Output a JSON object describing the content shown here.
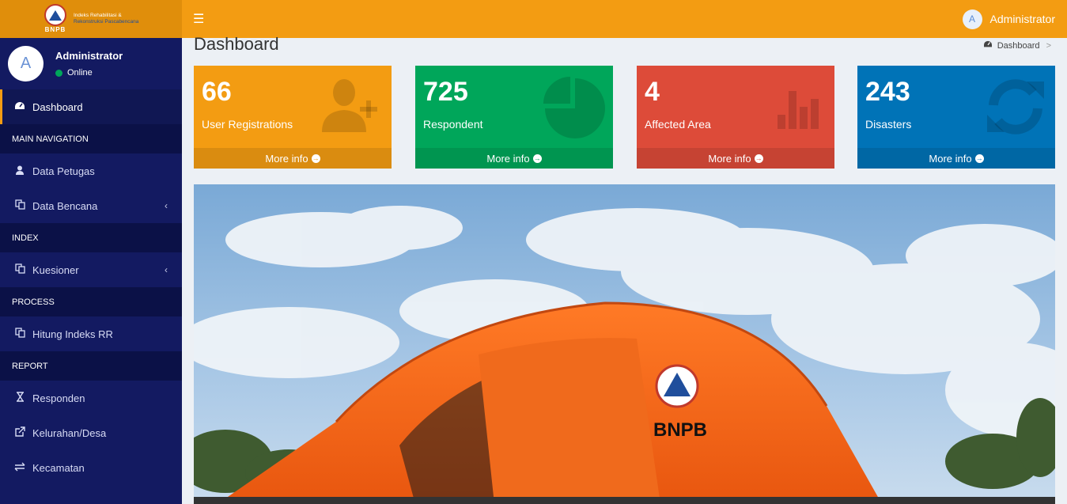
{
  "brand": {
    "logo_letters": "BNPB",
    "line1": "Indeks Rehabilitasi &",
    "line2": "Rekonstruksi Pascabencana"
  },
  "navbar": {
    "toggle_icon": "bars-icon",
    "user_initial": "A",
    "user_name": "Administrator"
  },
  "sidebar": {
    "user_initial": "A",
    "user_name": "Administrator",
    "user_status": "Online",
    "items": [
      {
        "label": "Dashboard",
        "icon": "dashboard-icon"
      },
      {
        "header": "MAIN NAVIGATION"
      },
      {
        "label": "Data Petugas",
        "icon": "user-icon"
      },
      {
        "label": "Data Bencana",
        "icon": "copy-icon"
      },
      {
        "header": "INDEX"
      },
      {
        "label": "Kuesioner",
        "icon": "copy-icon"
      },
      {
        "header": "PROCESS"
      },
      {
        "label": "Hitung Indeks RR",
        "icon": "copy-icon"
      },
      {
        "header": "REPORT"
      },
      {
        "label": "Responden",
        "icon": "hourglass-icon"
      },
      {
        "label": "Kelurahan/Desa",
        "icon": "external-link-icon"
      },
      {
        "label": "Kecamatan",
        "icon": "exchange-icon"
      }
    ]
  },
  "page": {
    "title": "Dashboard",
    "breadcrumb": "Dashboard",
    "breadcrumb_sep": ">"
  },
  "stats": [
    {
      "value": "66",
      "label": "User Registrations",
      "more": "More info",
      "icon": "user-plus-icon",
      "color": "#f39c12"
    },
    {
      "value": "725",
      "label": "Respondent",
      "more": "More info",
      "icon": "pie-chart-icon",
      "color": "#00a65a"
    },
    {
      "value": "4",
      "label": "Affected Area",
      "more": "More info",
      "icon": "bar-chart-icon",
      "color": "#dd4b39"
    },
    {
      "value": "243",
      "label": "Disasters",
      "more": "More info",
      "icon": "refresh-icon",
      "color": "#0073b7"
    }
  ],
  "banner": {
    "tent_text": "BNPB",
    "colors": {
      "sky": "#8cb5db",
      "tent": "#f26a1b"
    }
  }
}
